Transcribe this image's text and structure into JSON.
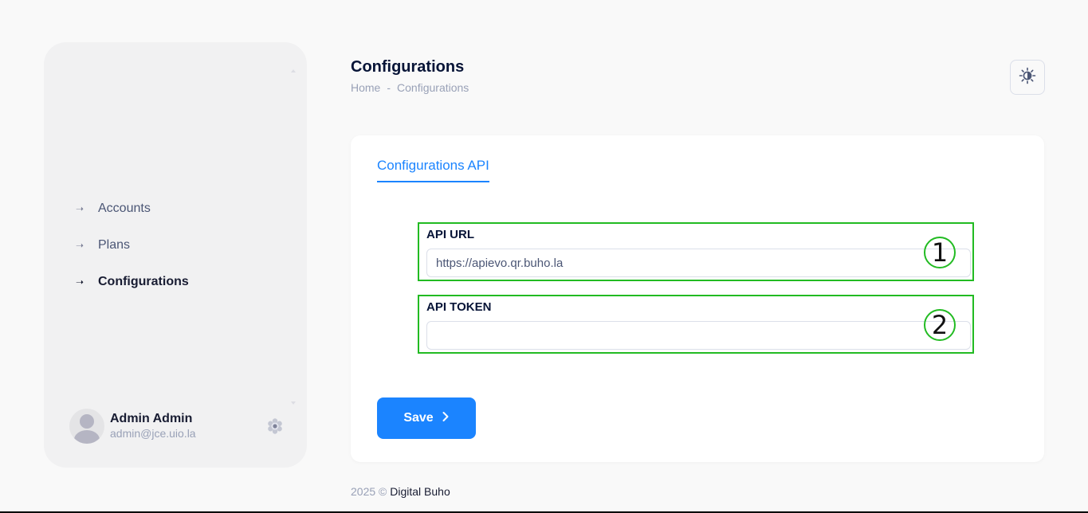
{
  "header": {
    "title": "Configurations",
    "breadcrumb": [
      "Home",
      "-",
      "Configurations"
    ]
  },
  "sidebar": {
    "items": [
      {
        "label": "Accounts",
        "active": false
      },
      {
        "label": "Plans",
        "active": false
      },
      {
        "label": "Configurations",
        "active": true
      }
    ],
    "user": {
      "name": "Admin Admin",
      "email": "admin@jce.uio.la"
    }
  },
  "card": {
    "tab_label": "Configurations API",
    "fields": {
      "api_url": {
        "label": "API URL",
        "value": "https://apievo.qr.buho.la",
        "marker": "1"
      },
      "api_token": {
        "label": "API TOKEN",
        "value": "",
        "marker": "2"
      }
    },
    "save_label": "Save"
  },
  "footer": {
    "year": "2025",
    "copyright": "©",
    "brand": "Digital Buho"
  },
  "colors": {
    "accent": "#1b84ff",
    "annotation": "#22bb22",
    "sidebar_bg": "#f1f1f2"
  },
  "icons": {
    "theme": "sun-icon",
    "user_settings": "gear-icon",
    "nav": "arrow-right-icon",
    "save": "chevron-right-icon"
  }
}
